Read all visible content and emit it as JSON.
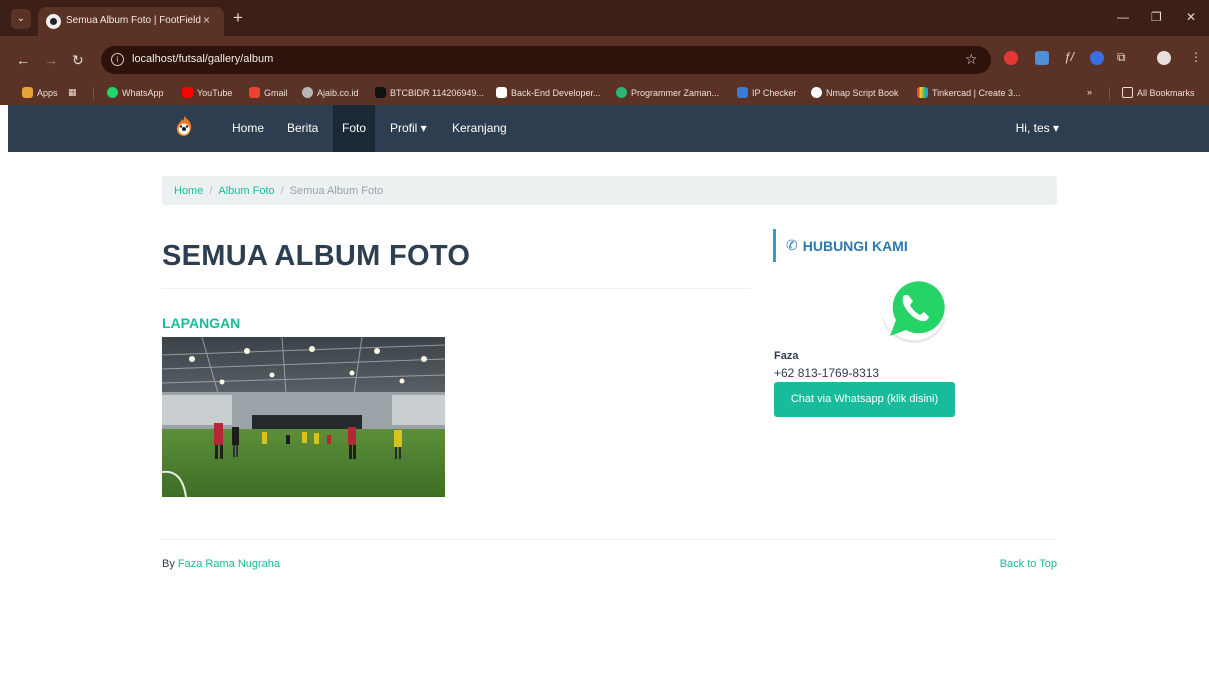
{
  "browser": {
    "tab_title": "Semua Album Foto | FootField",
    "tab_close": "×",
    "new_tab": "+",
    "url": "localhost/futsal/gallery/album",
    "bookmarks": {
      "apps": "Apps",
      "items": [
        "WhatsApp",
        "YouTube",
        "Gmail",
        "Ajaib.co.id",
        "BTCBIDR 114206949...",
        "Back-End Developer...",
        "Programmer Zaman...",
        "IP Checker",
        "Nmap Script Book",
        "Tinkercad | Create 3..."
      ],
      "more": "»",
      "all_bookmarks": "All Bookmarks"
    }
  },
  "navbar": {
    "links": [
      {
        "label": "Home"
      },
      {
        "label": "Berita"
      },
      {
        "label": "Foto"
      },
      {
        "label": "Profil ▾"
      },
      {
        "label": "Keranjang"
      }
    ],
    "user": "Hi, tes ▾"
  },
  "breadcrumb": {
    "home": "Home",
    "album": "Album Foto",
    "current": "Semua Album Foto",
    "separator": "/"
  },
  "page": {
    "title": "SEMUA ALBUM FOTO",
    "albums": [
      {
        "title": "LAPANGAN"
      }
    ]
  },
  "sidebar": {
    "heading": "HUBUNGI KAMI",
    "contact_name": "Faza",
    "contact_phone": "+62 813-1769-8313",
    "button_label": "Chat via Whatsapp (klik disini)"
  },
  "footer": {
    "by_prefix": "By",
    "author": "Faza Rama Nugraha",
    "back_to_top": "Back to Top"
  },
  "colors": {
    "accent": "#18bc9c",
    "navbar": "#2d3e50",
    "heading_blue": "#2c78b4"
  }
}
